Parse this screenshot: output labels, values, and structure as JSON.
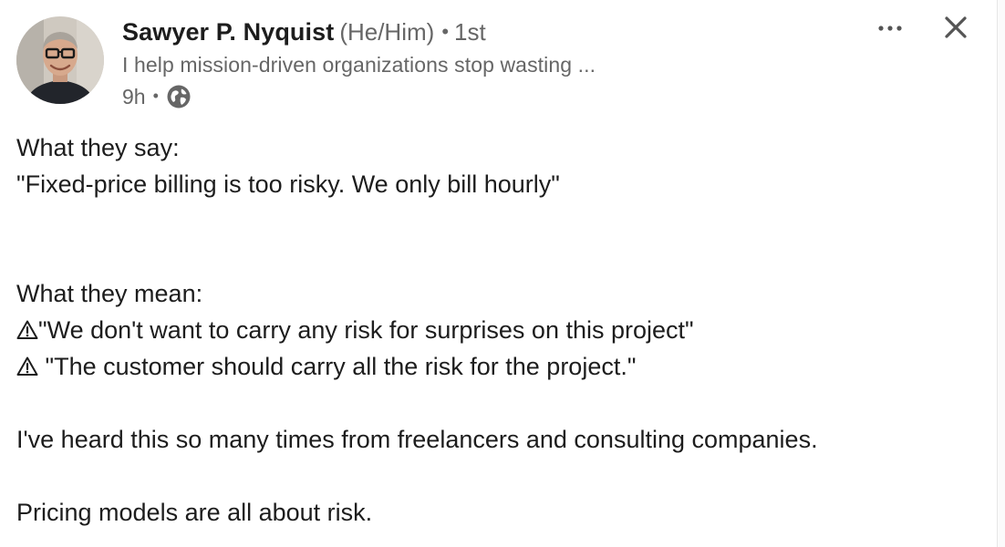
{
  "post": {
    "author": {
      "name": "Sawyer P. Nyquist",
      "pronouns": "(He/Him)",
      "separator": "•",
      "degree": "1st",
      "headline": "I help mission-driven organizations stop wasting ...",
      "time": "9h",
      "visibility_icon": "globe-icon"
    },
    "controls": {
      "more_icon": "more-horizontal-icon",
      "close_icon": "close-icon"
    },
    "body": {
      "say_heading": "What they say:",
      "say_quote": "\"Fixed-price billing is too risky. We only bill hourly\"",
      "mean_heading": "What they mean:",
      "mean_items": [
        {
          "icon": "warning-icon",
          "text": "\"We don't want to carry any risk for surprises on this project\""
        },
        {
          "icon": "warning-icon",
          "text": " \"The customer should carry all the risk for the project.\""
        }
      ],
      "paragraph_1": "I've heard this so many times from freelancers and consulting companies.",
      "paragraph_2": "Pricing models are all about risk."
    }
  },
  "colors": {
    "text_primary": "#1d1d1d",
    "text_secondary": "#666666",
    "background": "#ffffff"
  }
}
